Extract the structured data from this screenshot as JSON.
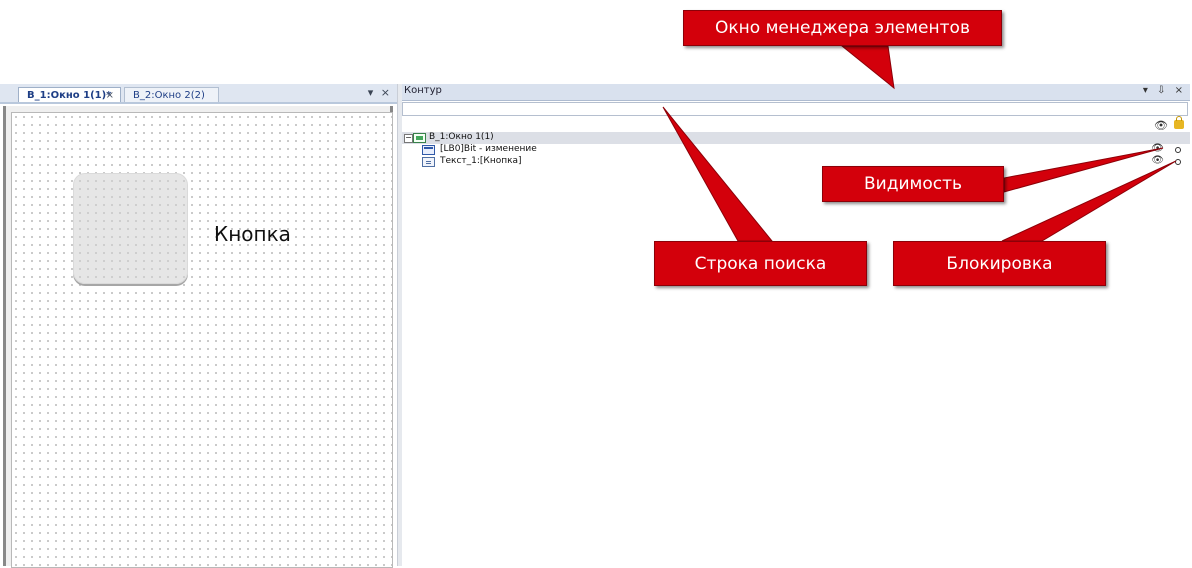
{
  "editor": {
    "tabs": [
      {
        "label": "B_1:Окно 1(1)*",
        "close": "×",
        "active": true
      },
      {
        "label": "B_2:Окно 2(2)",
        "active": false
      }
    ],
    "pane_tools": "▾ ×",
    "canvas": {
      "button_text": "Кнопка"
    }
  },
  "outline": {
    "title": "Контур",
    "tools": "▾ ⇩ ×",
    "search": {
      "value": "",
      "placeholder": ""
    },
    "toolbar": {
      "eye_icon": "👁",
      "lock_icon": "lock"
    },
    "tree": [
      {
        "label": "B_1:Окно 1(1)",
        "expander": "−",
        "icon": "window-icon",
        "level": 0
      },
      {
        "label": "[LB0]Bit - изменение",
        "icon": "bit-button-icon",
        "level": 1,
        "visibility": "👁"
      },
      {
        "label": "Текст_1:[Кнопка]",
        "icon": "text-icon",
        "level": 1,
        "visibility": "👁"
      }
    ]
  },
  "callouts": {
    "manager": "Окно менеджера элементов",
    "visibility": "Видимость",
    "search": "Строка поиска",
    "lock": "Блокировка"
  },
  "colors": {
    "callout_red": "#d3000b",
    "tab_text": "#1f3f86",
    "header_bg": "#d9e1ee"
  }
}
